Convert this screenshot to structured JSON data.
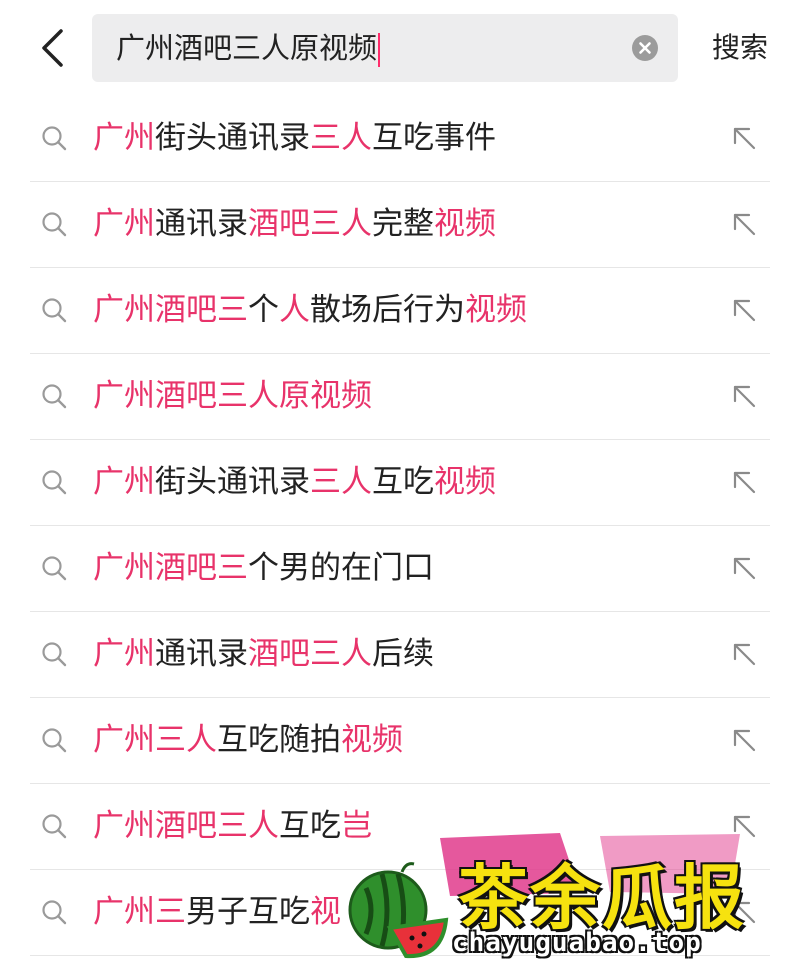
{
  "header": {
    "query": "广州酒吧三人原视频",
    "submit_label": "搜索"
  },
  "suggestions": [
    {
      "parts": [
        {
          "t": "广州",
          "h": true
        },
        {
          "t": "街头通讯录",
          "h": false
        },
        {
          "t": "三人",
          "h": true
        },
        {
          "t": "互吃事件",
          "h": false
        }
      ]
    },
    {
      "parts": [
        {
          "t": "广州",
          "h": true
        },
        {
          "t": "通讯录",
          "h": false
        },
        {
          "t": "酒吧三人",
          "h": true
        },
        {
          "t": "完整",
          "h": false
        },
        {
          "t": "视频",
          "h": true
        }
      ]
    },
    {
      "parts": [
        {
          "t": "广州酒吧三",
          "h": true
        },
        {
          "t": "个",
          "h": false
        },
        {
          "t": "人",
          "h": true
        },
        {
          "t": "散场后行为",
          "h": false
        },
        {
          "t": "视频",
          "h": true
        }
      ]
    },
    {
      "parts": [
        {
          "t": "广州酒吧三人原视频",
          "h": true
        }
      ]
    },
    {
      "parts": [
        {
          "t": "广州",
          "h": true
        },
        {
          "t": "街头通讯录",
          "h": false
        },
        {
          "t": "三人",
          "h": true
        },
        {
          "t": "互吃",
          "h": false
        },
        {
          "t": "视频",
          "h": true
        }
      ]
    },
    {
      "parts": [
        {
          "t": "广州酒吧三",
          "h": true
        },
        {
          "t": "个男的在门口",
          "h": false
        }
      ]
    },
    {
      "parts": [
        {
          "t": "广州",
          "h": true
        },
        {
          "t": "通讯录",
          "h": false
        },
        {
          "t": "酒吧三人",
          "h": true
        },
        {
          "t": "后续",
          "h": false
        }
      ]
    },
    {
      "parts": [
        {
          "t": "广州三人",
          "h": true
        },
        {
          "t": "互吃随拍",
          "h": false
        },
        {
          "t": "视频",
          "h": true
        }
      ]
    },
    {
      "parts": [
        {
          "t": "广州酒吧三人",
          "h": true
        },
        {
          "t": "互吃",
          "h": false
        },
        {
          "t": "岂",
          "h": true
        }
      ]
    },
    {
      "parts": [
        {
          "t": "广州三",
          "h": true
        },
        {
          "t": "男子互吃",
          "h": false
        },
        {
          "t": "视",
          "h": true
        }
      ]
    }
  ],
  "watermark": {
    "title": "茶余瓜报",
    "url": "chayuguabao.top"
  },
  "colors": {
    "highlight": "#e8336a",
    "caret": "#ff2c6b",
    "search_bg": "#ededee"
  },
  "icons": {
    "back": "chevron-left-icon",
    "clear": "clear-circle-icon",
    "suggestion": "search-icon",
    "fill": "arrow-up-left-icon"
  }
}
